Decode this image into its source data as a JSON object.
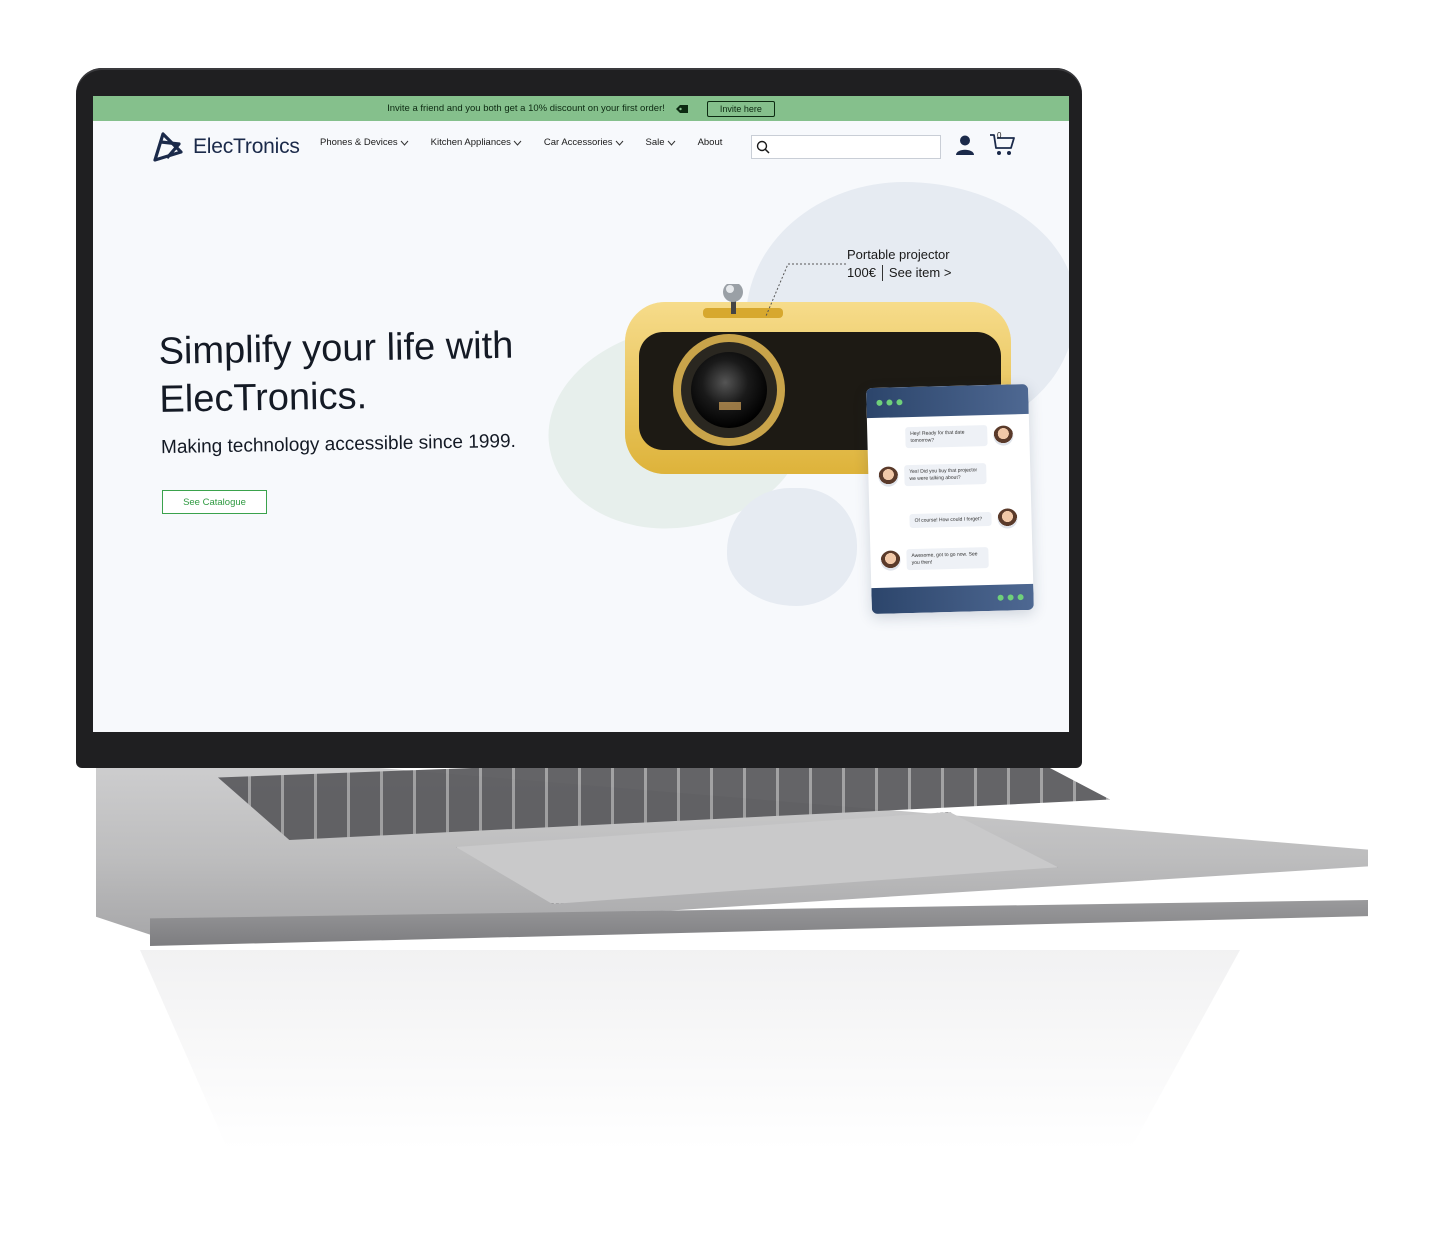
{
  "promo": {
    "text": "Invite a friend and you both get a 10% discount on your first order!",
    "button_label": "Invite here"
  },
  "brand": {
    "name": "ElecTronics"
  },
  "menu": [
    {
      "label": "Phones & Devices",
      "has_dropdown": true
    },
    {
      "label": "Kitchen Appliances",
      "has_dropdown": true
    },
    {
      "label": "Car Accessories",
      "has_dropdown": true
    },
    {
      "label": "Sale",
      "has_dropdown": true
    },
    {
      "label": "About",
      "has_dropdown": false
    }
  ],
  "search": {
    "placeholder": ""
  },
  "cart": {
    "count": "0"
  },
  "hero": {
    "title": "Simplify your life with ElecTronics.",
    "subtitle": "Making technology accessible since 1999.",
    "cta_label": "See Catalogue"
  },
  "product_callout": {
    "name": "Portable projector",
    "price": "100€",
    "link": "See item >"
  },
  "chat": {
    "messages": [
      {
        "side": "right",
        "text": "Hey! Ready for that date tomorrow?"
      },
      {
        "side": "left",
        "text": "Yes! Did you buy that projector we were talking about?"
      },
      {
        "side": "right",
        "text": "Of course! How could I forget?"
      },
      {
        "side": "left",
        "text": "Awesome, got to go now. See you then!"
      }
    ]
  },
  "colors": {
    "promo_bar": "#85c08c",
    "accent_green": "#3aa24c",
    "brand_navy": "#1b2a4a",
    "projector_yellow": "#f2c94c",
    "chat_header": "#2c456b"
  }
}
